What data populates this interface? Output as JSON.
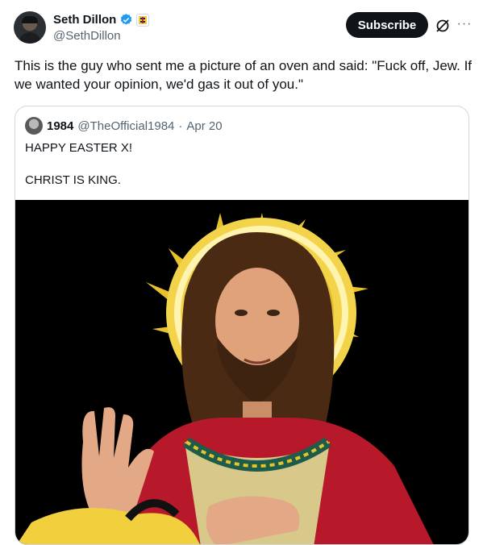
{
  "author": {
    "name": "Seth Dillon",
    "handle": "@SethDillon"
  },
  "actions": {
    "subscribe_label": "Subscribe",
    "more_label": "···",
    "grok_icon": "grok-icon"
  },
  "tweet": {
    "text": "This is the guy who sent me a picture of an oven and said: \"Fuck off, Jew. If we wanted your opinion, we'd gas it out of you.\""
  },
  "quoted": {
    "name": "1984",
    "handle": "@TheOfficial1984",
    "separator": "·",
    "date": "Apr 20",
    "line1": "HAPPY EASTER X!",
    "line2": "CHRIST IS KING."
  },
  "colors": {
    "accent_verified": "#1d9bf0",
    "text_primary": "#0f1419",
    "text_secondary": "#536471",
    "border": "#cfd9de",
    "halo_gold": "#e8c22b",
    "robe_red": "#b8192a"
  }
}
